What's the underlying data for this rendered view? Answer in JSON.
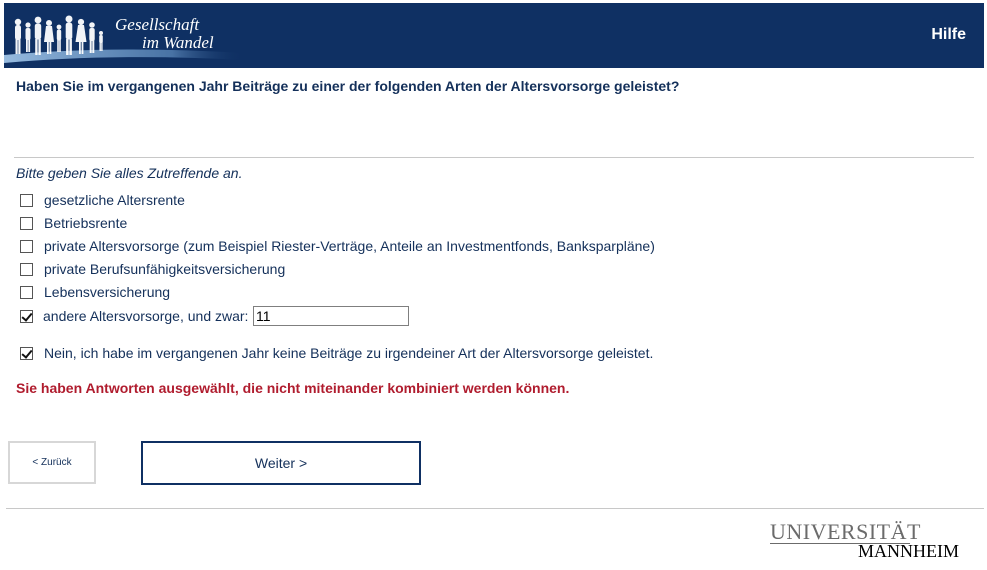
{
  "header": {
    "logo_line1": "Gesellschaft",
    "logo_line2": "im Wandel",
    "help_link": "Hilfe"
  },
  "question": {
    "text": "Haben Sie im vergangenen Jahr Beiträge zu einer der folgenden Arten der Altersvorsorge geleistet?",
    "instruction": "Bitte geben Sie alles Zutreffende an."
  },
  "options": [
    {
      "label": "gesetzliche Altersrente",
      "checked": false
    },
    {
      "label": "Betriebsrente",
      "checked": false
    },
    {
      "label": "private Altersvorsorge (zum Beispiel Riester-Verträge, Anteile an Investmentfonds, Banksparpläne)",
      "checked": false
    },
    {
      "label": "private Berufsunfähigkeitsversicherung",
      "checked": false
    },
    {
      "label": "Lebensversicherung",
      "checked": false
    },
    {
      "label": "andere Altersvorsorge, und zwar:",
      "checked": true,
      "input_value": "11"
    },
    {
      "label": "Nein, ich habe im vergangenen Jahr keine Beiträge zu irgendeiner Art der Altersvorsorge geleistet.",
      "checked": true
    }
  ],
  "error_message": "Sie haben Antworten ausgewählt, die nicht miteinander kombiniert werden können.",
  "navigation": {
    "back_label": "< Zurück",
    "next_label": "Weiter >"
  },
  "footer": {
    "university_line1": "UNIVERSITÄT",
    "university_line2": "MANNHEIM"
  },
  "colors": {
    "header_bg": "#0f3063",
    "text": "#14305a",
    "error": "#b01c2e"
  }
}
